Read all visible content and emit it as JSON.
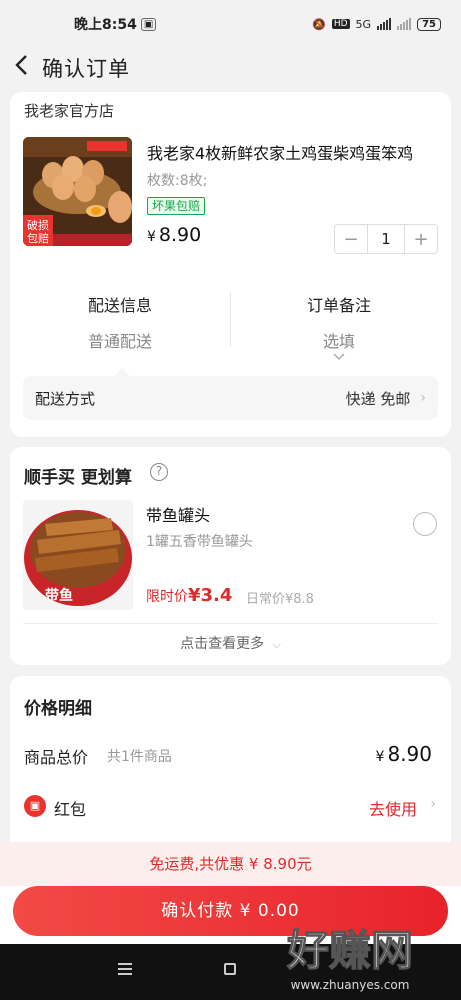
{
  "status_bar": {
    "time": "晚上8:54",
    "network": "5G",
    "hd": "HD",
    "battery": "75"
  },
  "header": {
    "title": "确认订单"
  },
  "store": {
    "name": "我老家官方店"
  },
  "product": {
    "title": "我老家4枚新鲜农家土鸡蛋柴鸡蛋笨鸡",
    "spec": "枚数:8枚;",
    "tag": "坏果包赔",
    "currency": "¥",
    "price": "8.90",
    "quantity": "1",
    "image_badge": "破损包赔"
  },
  "options": {
    "delivery_label": "配送信息",
    "delivery_value": "普通配送",
    "remark_label": "订单备注",
    "remark_value": "选填",
    "ship_method_label": "配送方式",
    "ship_method_value": "快递 免邮"
  },
  "upsell": {
    "title": "顺手买 更划算",
    "item_name": "带鱼罐头",
    "item_desc": "1罐五香带鱼罐头",
    "limited_label": "限时价",
    "limited_price": "¥3.4",
    "regular_price": "日常价¥8.8",
    "see_more": "点击查看更多"
  },
  "price_detail": {
    "title": "价格明细",
    "goods_total_label": "商品总价",
    "goods_count": "共1件商品",
    "currency": "¥",
    "goods_total": "8.90",
    "hongbao_label": "红包",
    "hongbao_action": "去使用"
  },
  "footer": {
    "savings": "免运费,共优惠 ¥ 8.90元",
    "pay_button": "确认付款 ¥ 0.00"
  },
  "watermark": {
    "text": "好赚网",
    "url": "www.zhuanyes.com"
  },
  "colors": {
    "accent": "#e02b2b",
    "tag_green": "#1aa64b",
    "background": "#f2f2f2"
  }
}
